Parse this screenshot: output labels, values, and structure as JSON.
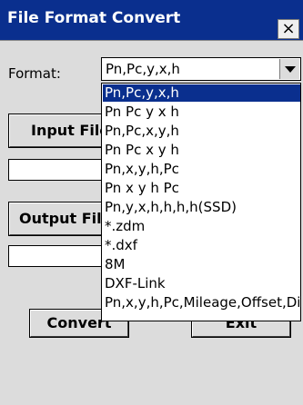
{
  "window": {
    "title": "File Format Convert",
    "close_label": "×"
  },
  "format": {
    "label": "Format:",
    "selected": "Pn,Pc,y,x,h",
    "options": [
      "Pn,Pc,y,x,h",
      "Pn Pc y x h",
      "Pn,Pc,x,y,h",
      "Pn Pc x y h",
      "Pn,x,y,h,Pc",
      "Pn x y h Pc",
      "Pn,y,x,h,h,h,h(SSD)",
      "*.zdm",
      "*.dxf",
      "8M",
      "DXF-Link",
      "Pn,x,y,h,Pc,Mileage,Offset,Di"
    ],
    "highlighted_index": 0
  },
  "buttons": {
    "input_file": "Input File",
    "output_file": "Output File",
    "convert": "Convert",
    "exit": "Exit"
  },
  "paths": {
    "input": "",
    "output": ""
  },
  "colors": {
    "titlebar": "#0a2f8e",
    "highlight": "#0a2f8e",
    "window_bg": "#dcdcdc"
  }
}
